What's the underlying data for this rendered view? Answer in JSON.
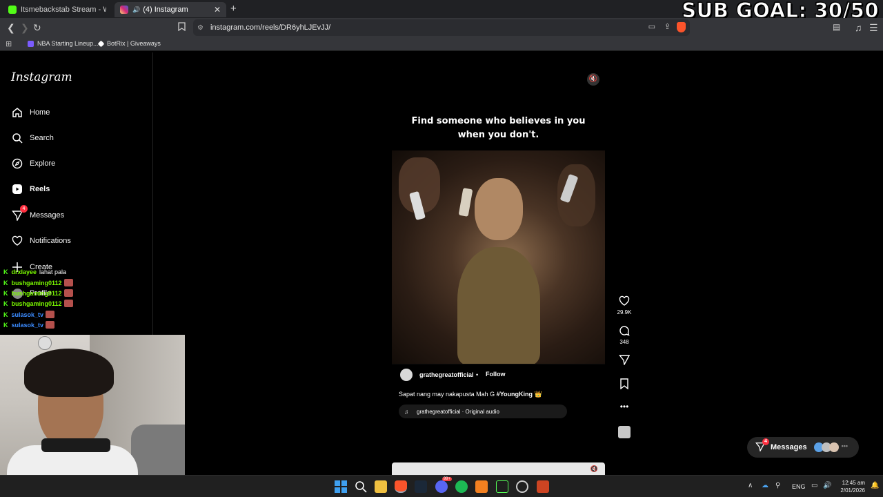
{
  "browser": {
    "tabs": [
      {
        "label": "Itsmebackstab Stream - Watch Live o",
        "icon": "kick-icon",
        "color": "#53fc18"
      },
      {
        "label": "(4) Instagram",
        "icon": "instagram-icon",
        "color": "#e1306c",
        "active": true
      }
    ],
    "url": "instagram.com/reels/DR6yhLJEvJJ/",
    "bookmarks": [
      {
        "label": "NBA Starting Lineup...",
        "color": "#7b5cff"
      },
      {
        "label": "BotRix | Giveaways",
        "color": "#ffffff"
      }
    ]
  },
  "overlay": {
    "sub_goal": "SUB GOAL: 30/50",
    "chat": [
      {
        "user": "drxlayee",
        "message": "lahat pala",
        "user_color": "#7CFC00"
      },
      {
        "user": "bushgaming0112",
        "message": "",
        "user_color": "#7CFC00"
      },
      {
        "user": "bushgaming0112",
        "message": "",
        "user_color": "#7CFC00"
      },
      {
        "user": "bushgaming0112",
        "message": "",
        "user_color": "#7CFC00"
      },
      {
        "user": "sulasok_tv",
        "message": "",
        "user_color": "#3c8cff"
      },
      {
        "user": "sulasok_tv",
        "message": "",
        "user_color": "#3c8cff"
      }
    ]
  },
  "instagram": {
    "logo": "Instagram",
    "nav": [
      {
        "label": "Home",
        "icon": "home-icon"
      },
      {
        "label": "Search",
        "icon": "search-icon"
      },
      {
        "label": "Explore",
        "icon": "compass-icon"
      },
      {
        "label": "Reels",
        "icon": "reels-icon",
        "active": true
      },
      {
        "label": "Messages",
        "icon": "messenger-icon",
        "badge": "4"
      },
      {
        "label": "Notifications",
        "icon": "heart-icon"
      },
      {
        "label": "Create",
        "icon": "plus-icon"
      },
      {
        "label": "Profile",
        "icon": "avatar-icon"
      }
    ],
    "reel": {
      "caption_overlay_line1": "Find someone who believes in you",
      "caption_overlay_line2": "when you don't.",
      "username": "grathegreatofficial",
      "separator": "•",
      "follow_label": "Follow",
      "caption": "Sapat nang may nakapusta Mah G",
      "hashtag": "#YoungKing",
      "emoji": "👑",
      "audio": "grathegreatofficial · Original audio",
      "likes": "29.9K",
      "comments": "348"
    },
    "messages_pill": {
      "label": "Messages",
      "badge": "4"
    }
  },
  "taskbar": {
    "lang": "ENG",
    "time": "12:45 am",
    "date": "2/01/2026",
    "discord_badge": "99+"
  }
}
